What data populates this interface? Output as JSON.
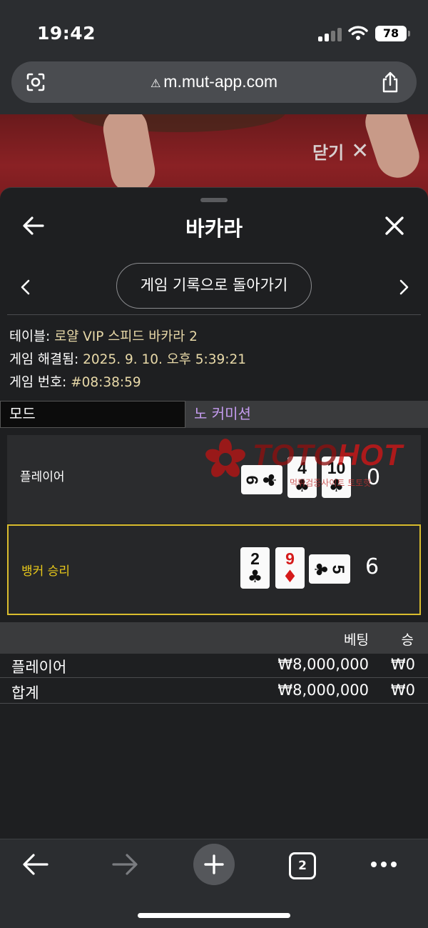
{
  "status_bar": {
    "time": "19:42",
    "battery": "78"
  },
  "browser": {
    "url": "m.mut-app.com",
    "warning_glyph": "⚠",
    "tab_count": "2"
  },
  "background": {
    "close_label": "닫기"
  },
  "sheet": {
    "title": "바카라",
    "back_to_history": "게임 기록으로 돌아가기",
    "info": {
      "table_label": "테이블: ",
      "table_value": "로얄 VIP 스피드 바카라 2",
      "resolved_label": "게임 해결됨: ",
      "resolved_value": "2025. 9. 10. 오후 5:39:21",
      "number_label": "게임 번호: ",
      "number_value": "#08:38:59"
    },
    "mode": {
      "label": "모드",
      "value": "노 커미션"
    },
    "player": {
      "label": "플레이어",
      "score": "0",
      "cards": [
        {
          "rank": "9",
          "suit": "♣",
          "color": "black",
          "orientation": "sideways"
        },
        {
          "rank": "4",
          "suit": "♣",
          "color": "black",
          "orientation": "upright"
        },
        {
          "rank": "10",
          "suit": "♣",
          "color": "black",
          "orientation": "upright"
        }
      ]
    },
    "banker": {
      "label": "뱅커 승리",
      "score": "6",
      "cards": [
        {
          "rank": "2",
          "suit": "♣",
          "color": "black",
          "orientation": "upright"
        },
        {
          "rank": "9",
          "suit": "♦",
          "color": "red",
          "orientation": "upright"
        },
        {
          "rank": "5",
          "suit": "♣",
          "color": "black",
          "orientation": "sideways"
        }
      ]
    },
    "bets": {
      "col_bet": "베팅",
      "col_win": "승",
      "rows": [
        {
          "label": "플레이어",
          "amount": "₩8,000,000",
          "win": "₩0"
        },
        {
          "label": "합계",
          "amount": "₩8,000,000",
          "win": "₩0"
        }
      ]
    },
    "watermark": {
      "brand_a": "TOTO",
      "brand_b": "HOT",
      "tagline": "먹튀검증사이트 토토핫"
    }
  },
  "colors": {
    "banker_highlight": "#d9bd2e",
    "mode_value": "#c59cf0",
    "info_value": "#e8d9a8",
    "watermark_red": "#d21616"
  },
  "icons": [
    "signal-icon",
    "wifi-icon",
    "battery-icon",
    "lens-icon",
    "warning-icon",
    "share-icon",
    "close-icon",
    "back-arrow-icon",
    "chevron-left-icon",
    "chevron-right-icon",
    "plus-icon",
    "tabs-icon",
    "more-icon",
    "forward-arrow-icon",
    "club-suit-icon",
    "diamond-suit-icon"
  ]
}
